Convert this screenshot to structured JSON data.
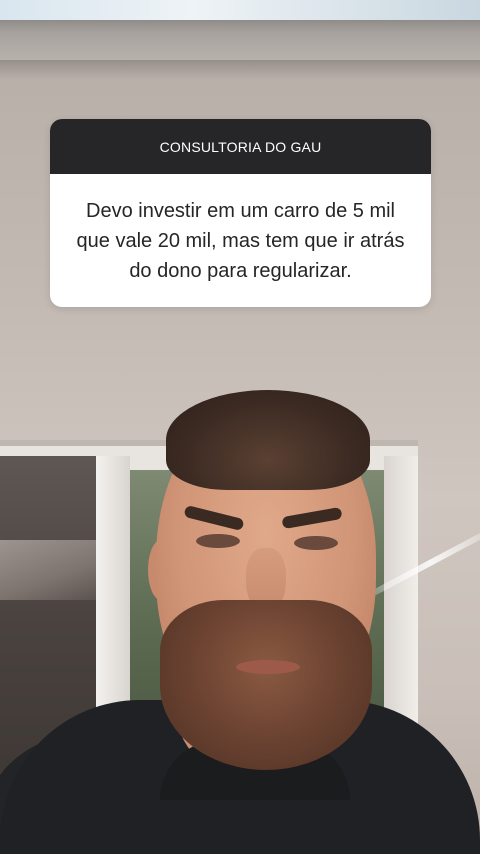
{
  "question_sticker": {
    "header": "CONSULTORIA DO GAU",
    "question": "Devo investir em um carro de 5 mil que vale 20 mil, mas tem que ir atrás do dono para regularizar."
  },
  "colors": {
    "sticker_header_bg": "#262628",
    "sticker_body_bg": "#ffffff"
  }
}
